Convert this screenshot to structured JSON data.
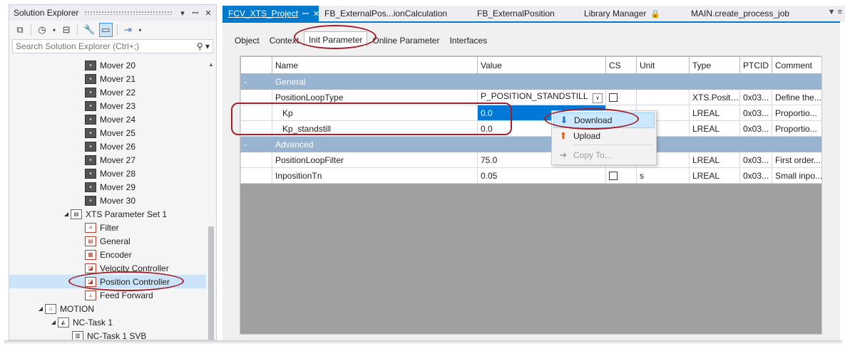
{
  "solution_explorer": {
    "title": "Solution Explorer",
    "search_placeholder": "Search Solution Explorer (Ctrl+;)",
    "tree": [
      {
        "label": "Mover 20",
        "icon": "mover-icon"
      },
      {
        "label": "Mover 21",
        "icon": "mover-icon"
      },
      {
        "label": "Mover 22",
        "icon": "mover-icon"
      },
      {
        "label": "Mover 23",
        "icon": "mover-icon"
      },
      {
        "label": "Mover 24",
        "icon": "mover-icon"
      },
      {
        "label": "Mover 25",
        "icon": "mover-icon"
      },
      {
        "label": "Mover 26",
        "icon": "mover-icon"
      },
      {
        "label": "Mover 27",
        "icon": "mover-icon"
      },
      {
        "label": "Mover 28",
        "icon": "mover-icon"
      },
      {
        "label": "Mover 29",
        "icon": "mover-icon"
      },
      {
        "label": "Mover 30",
        "icon": "mover-icon"
      },
      {
        "label": "XTS Parameter Set 1",
        "icon": "parameter-set-icon"
      },
      {
        "label": "Filter",
        "icon": "filter-icon"
      },
      {
        "label": "General",
        "icon": "document-icon"
      },
      {
        "label": "Encoder",
        "icon": "encoder-icon"
      },
      {
        "label": "Velocity Controller",
        "icon": "controller-icon"
      },
      {
        "label": "Position Controller",
        "icon": "controller-icon"
      },
      {
        "label": "Feed Forward",
        "icon": "feed-forward-icon"
      },
      {
        "label": "MOTION",
        "icon": "motion-icon"
      },
      {
        "label": "NC-Task 1",
        "icon": "nc-task-icon"
      },
      {
        "label": "NC-Task 1 SVB",
        "icon": "svb-icon"
      }
    ]
  },
  "editor_tabs": [
    {
      "label": "FCV_XTS_Project"
    },
    {
      "label": "FB_ExternalPos...ionCalculation"
    },
    {
      "label": "FB_ExternalPosition"
    },
    {
      "label": "Library Manager"
    },
    {
      "label": "MAIN.create_process_job"
    }
  ],
  "inner_tabs": [
    "Object",
    "Context",
    "Init Parameter",
    "Online Parameter",
    "Interfaces"
  ],
  "grid": {
    "columns": [
      "",
      "Name",
      "Value",
      "CS",
      "Unit",
      "Type",
      "PTCID",
      "Comment"
    ],
    "groups": {
      "general": "General",
      "advanced": "Advanced",
      "collapse": "-"
    },
    "rows": [
      {
        "name": "PositionLoopType",
        "value": "P_POSITION_STANDSTILL",
        "unit": "",
        "type": "XTS.Positi...",
        "ptcid": "0x03...",
        "comment": "Define the..."
      },
      {
        "name": "Kp",
        "value": "0.0",
        "unit": "",
        "type": "LREAL",
        "ptcid": "0x03...",
        "comment": "Proportio..."
      },
      {
        "name": "Kp_standstill",
        "value": "0.0",
        "unit": "",
        "type": "LREAL",
        "ptcid": "0x03...",
        "comment": "Proportio..."
      },
      {
        "name": "PositionLoopFilter",
        "value": "75.0",
        "unit": "",
        "type": "LREAL",
        "ptcid": "0x03...",
        "comment": "First order..."
      },
      {
        "name": "InpositionTn",
        "value": "0.05",
        "unit": "s",
        "type": "LREAL",
        "ptcid": "0x03...",
        "comment": "Small inpo..."
      }
    ]
  },
  "context_menu": {
    "items": [
      {
        "label": "Download",
        "icon": "download-icon"
      },
      {
        "label": "Upload",
        "icon": "upload-icon"
      },
      {
        "label": "Copy To...",
        "icon": "copy-to-icon"
      }
    ]
  },
  "colors": {
    "accent": "#007acc",
    "annotation": "#a3202a",
    "group_row": "#99b4d1",
    "selection": "#0078d7"
  }
}
